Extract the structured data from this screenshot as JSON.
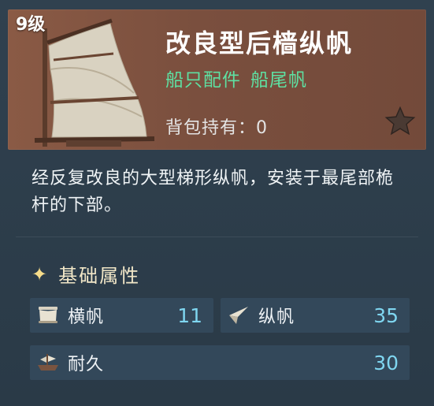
{
  "item": {
    "level": "9级",
    "name": "改良型后樯纵帆",
    "category": "船只配件",
    "subcategory": "船尾帆",
    "owned_label": "背包持有：",
    "owned_count": "0",
    "favorite_icon": "star-icon",
    "description": "经反复改良的大型梯形纵帆，安装于最尾部桅杆的下部。"
  },
  "attributes": {
    "section_title": "基础属性",
    "stats": [
      {
        "label": "横帆",
        "value": "11",
        "icon": "square-sail-icon"
      },
      {
        "label": "纵帆",
        "value": "35",
        "icon": "fore-aft-sail-icon"
      },
      {
        "label": "耐久",
        "value": "30",
        "icon": "ship-durability-icon"
      }
    ]
  },
  "colors": {
    "header_bg": "#7a4f3e",
    "panel_bg": "#2c3d4a",
    "stat_bg": "#33485a",
    "subtitle": "#5ee0a2",
    "stat_value": "#7fd6f0",
    "section_title": "#f2e7c8"
  }
}
